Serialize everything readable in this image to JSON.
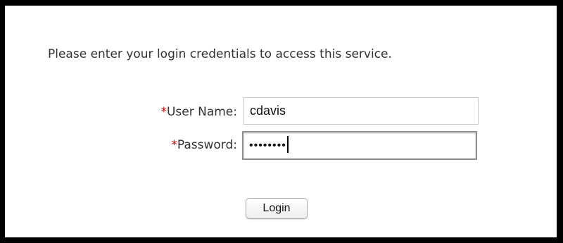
{
  "intro_text": "Please enter your login credentials to access this service.",
  "form": {
    "required_marker": "*",
    "username": {
      "label": "User Name:",
      "value": "cdavis"
    },
    "password": {
      "label": "Password:",
      "masked_value": "••••••••",
      "focused": true
    },
    "login_label": "Login"
  },
  "colors": {
    "frame": "#000000",
    "text": "#333333",
    "required": "#cc0000"
  }
}
